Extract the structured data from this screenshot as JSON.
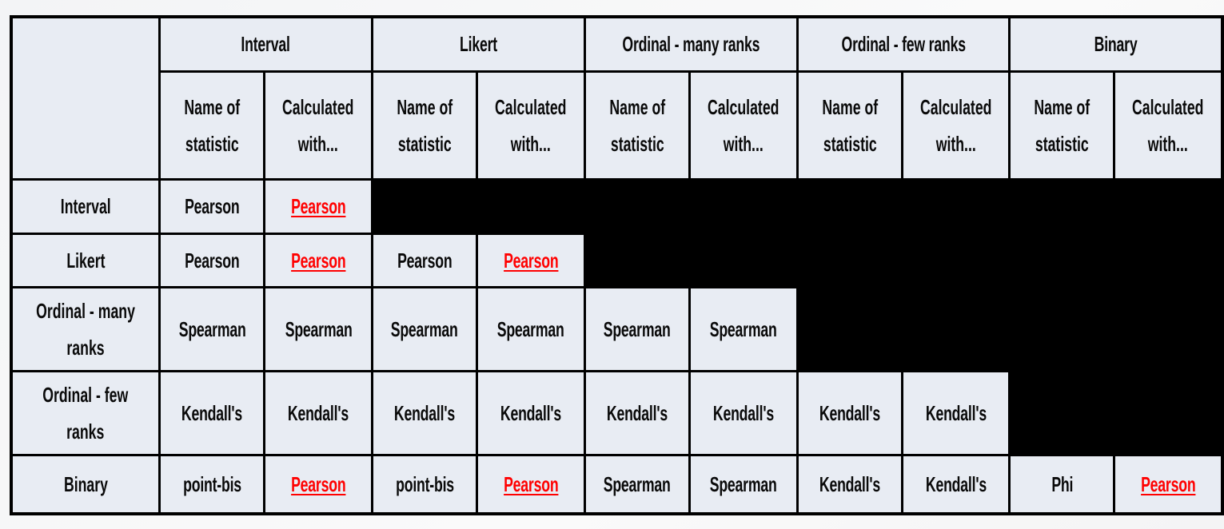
{
  "table": {
    "corner_label": "",
    "column_groups": [
      "Interval",
      "Likert",
      "Ordinal - many ranks",
      "Ordinal - few ranks",
      "Binary"
    ],
    "subheaders": {
      "name_line1": "Name of",
      "name_line2": "statistic",
      "calc_line1": "Calculated",
      "calc_line2": "with..."
    },
    "rows": [
      {
        "label_line1": "Interval",
        "label_line2": "",
        "cells": [
          {
            "name": "Pearson",
            "calc": "Pearson"
          },
          null,
          null,
          null,
          null
        ]
      },
      {
        "label_line1": "Likert",
        "label_line2": "",
        "cells": [
          {
            "name": "Pearson",
            "calc": "Pearson"
          },
          {
            "name": "Pearson",
            "calc": "Pearson"
          },
          null,
          null,
          null
        ]
      },
      {
        "label_line1": "Ordinal - many",
        "label_line2": "ranks",
        "cells": [
          {
            "name": "Spearman",
            "calc": "Spearman"
          },
          {
            "name": "Spearman",
            "calc": "Spearman"
          },
          {
            "name": "Spearman",
            "calc": "Spearman"
          },
          null,
          null
        ]
      },
      {
        "label_line1": "Ordinal - few",
        "label_line2": "ranks",
        "cells": [
          {
            "name": "Kendall's",
            "calc": "Kendall's"
          },
          {
            "name": "Kendall's",
            "calc": "Kendall's"
          },
          {
            "name": "Kendall's",
            "calc": "Kendall's"
          },
          {
            "name": "Kendall's",
            "calc": "Kendall's"
          },
          null
        ]
      },
      {
        "label_line1": "Binary",
        "label_line2": "",
        "cells": [
          {
            "name": "point-bis",
            "calc": "Pearson"
          },
          {
            "name": "point-bis",
            "calc": "Pearson"
          },
          {
            "name": "Spearman",
            "calc": "Spearman"
          },
          {
            "name": "Kendall's",
            "calc": "Kendall's"
          },
          {
            "name": "Phi",
            "calc": "Pearson"
          }
        ]
      }
    ],
    "linked_values": [
      "Pearson"
    ]
  },
  "colors": {
    "cell_background": "#e8ecf3",
    "border": "#000000",
    "link_red": "#ff0000",
    "text": "#0a0a0a"
  }
}
